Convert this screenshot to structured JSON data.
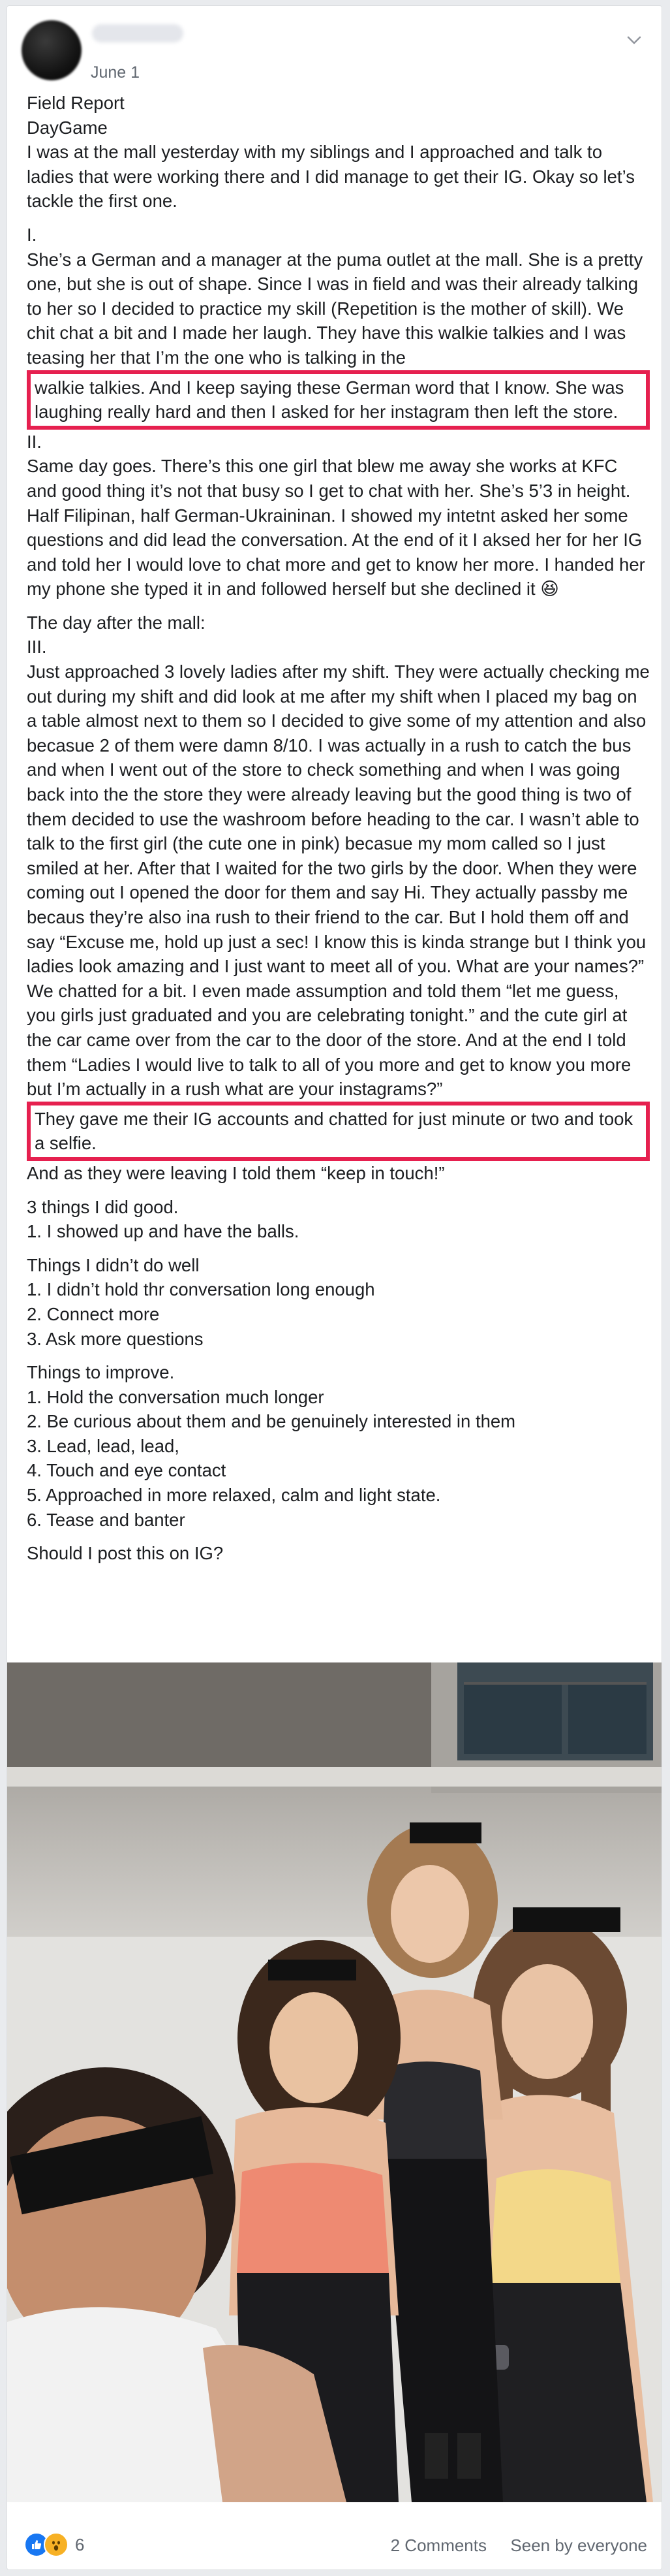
{
  "post": {
    "author": "",
    "date": "June 1",
    "body": [
      "Field Report",
      "DayGame",
      "I was at the mall yesterday with my siblings and I approached and talk to ladies that were working there and I did manage to get their IG. Okay so let’s tackle the first one.",
      "I.",
      "She’s a German and a manager at the puma outlet at the mall. She is a pretty one, but she is out of shape. Since I was in field and was their already talking to her so I decided to practice my skill (Repetition is the mother of skill). We chit chat a bit and I made her laugh. They have this walkie talkies and I was teasing her that I’m the one who is talking in the",
      "walkie talkies. And I keep saying these German word that I know. She was laughing really hard and then I asked for her instagram then left the store.",
      "II.",
      "Same day goes. There’s this one girl that blew me away she works at KFC and good thing it’s not that busy so I get to chat with her. She’s 5’3 in height. Half Filipinan, half German-Ukraininan. I showed my intetnt asked her some questions and did lead the conversation. At the end of it I aksed her for her IG and told her I would love to chat more and get to know her more. I handed her my phone she typed it in and followed herself but she declined it 😆",
      "The day after the mall:",
      "III.",
      "Just approached 3 lovely ladies after my shift. They were actually checking me out during my shift and did look at me after my shift when I placed my bag on a table almost next to them so I decided to give some of my attention and also becasue 2 of them were damn 8/10. I was actually in a rush to catch the bus and when I went out of the store to check something and when I was going back into the the store they were already leaving but the good thing is two of them decided to use the washroom before heading to the car. I wasn’t able to talk to the first girl (the cute one in pink) becasue my mom called so I just smiled at her. After that I waited for the two girls by the door. When they were coming out I opened the door for them and say Hi. They actually passby me becaus they’re also ina rush to their friend to the car. But I hold them off and say “Excuse me, hold up just a sec! I know this is kinda strange but I think you ladies look amazing and I just want to meet all of you. What are your names?” We chatted for a bit. I even made assumption and told them “let me guess, you girls just graduated and you are celebrating tonight.” and the cute girl at the car came over from the car to the door of the store. And at the end I told them “Ladies I would live to talk to all of you more and get to know you more but I’m actually in a rush what are your instagrams?”",
      "They gave me their IG accounts and chatted for just minute or two and took a selfie.",
      "And as they were leaving I told them “keep in touch!”",
      "3 things I did good.",
      "1. I showed up and have the balls.",
      "Things I didn’t do well",
      "1. I didn’t hold thr conversation long enough",
      "2. Connect more",
      "3. Ask more questions",
      "Things to improve.",
      "1. Hold the conversation much longer",
      "2. Be curious about them and be genuinely interested in them",
      "3. Lead, lead, lead,",
      "4. Touch and eye contact",
      "5. Approached in more relaxed, calm and light state.",
      "6. Tease and banter",
      "Should I post this on IG?"
    ]
  },
  "footer": {
    "reaction_count": "6",
    "comments": "2 Comments",
    "seen_by": "Seen by everyone"
  },
  "colors": {
    "highlight_box": "#e6204f",
    "like_blue": "#1877f2",
    "wow_yellow": "#f7b125",
    "meta_gray": "#606770"
  },
  "icons": {
    "menu": "chevron-down-icon",
    "like": "like-icon",
    "wow": "wow-icon"
  }
}
